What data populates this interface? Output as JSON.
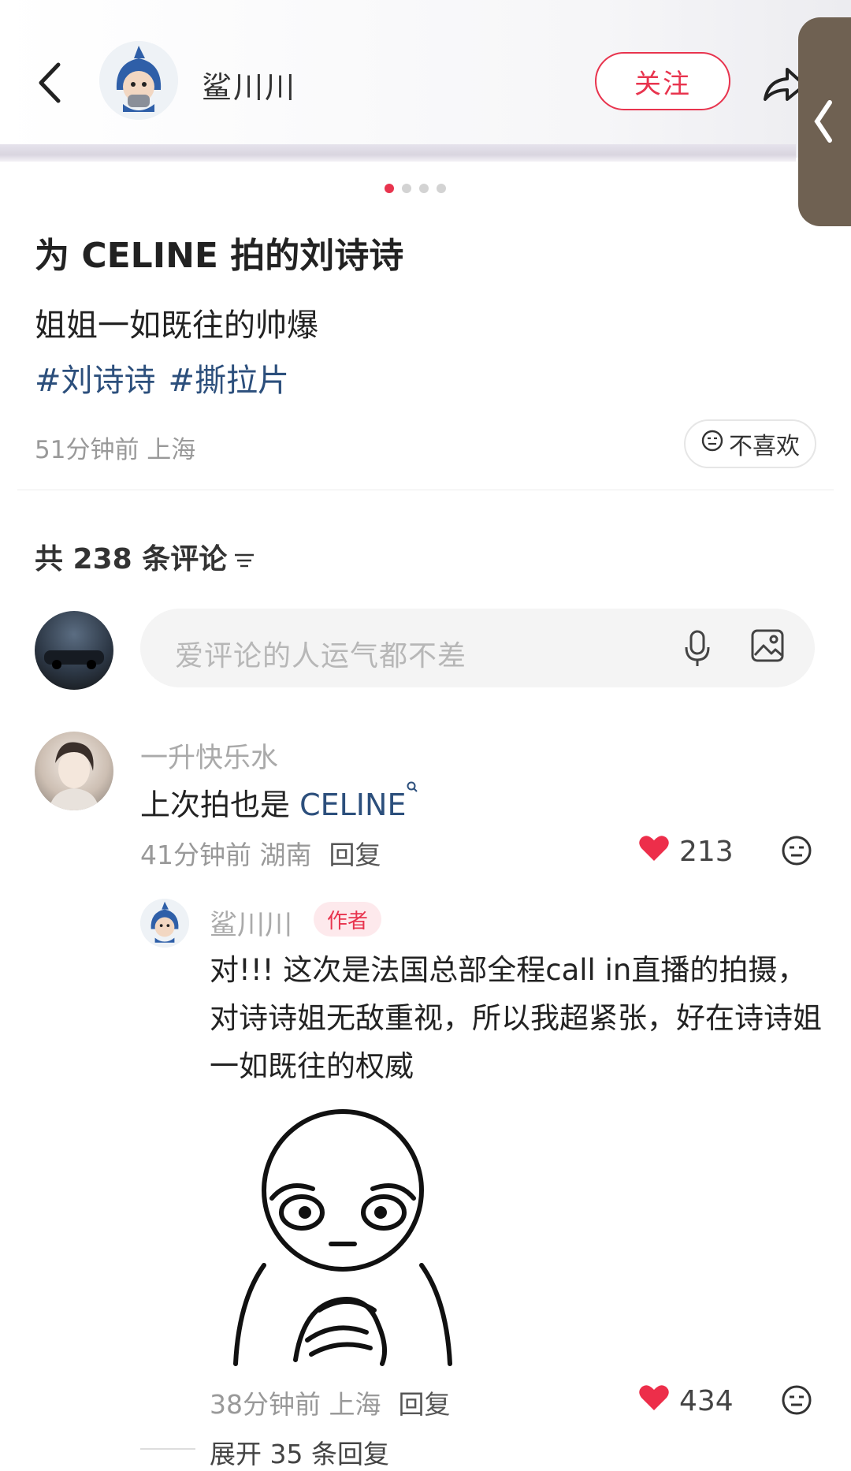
{
  "header": {
    "author_name": "鲨川川",
    "follow_label": "关注",
    "icons": [
      "back-arrow-icon",
      "shark-avatar",
      "share-icon",
      "side-collapse-icon"
    ]
  },
  "post": {
    "title": "为 CELINE 拍的刘诗诗",
    "body": "姐姐一如既往的帅爆",
    "tags": [
      "#刘诗诗",
      "#撕拉片"
    ],
    "meta": "51分钟前  上海",
    "dislike_label": "不喜欢",
    "carousel": {
      "total": 4,
      "active": 1
    }
  },
  "comments_header": {
    "label": "共 238 条评论"
  },
  "comment_input": {
    "placeholder": "爱评论的人运气都不差"
  },
  "comments": [
    {
      "name": "一升快乐水",
      "text_prefix": "上次拍也是 ",
      "text_link": "CELINE",
      "meta": "41分钟前  湖南",
      "reply_label": "回复",
      "likes": "213"
    }
  ],
  "reply": {
    "name": "鲨川川",
    "badge": "作者",
    "text": "对!!! 这次是法国总部全程call in直播的拍摄，对诗诗姐无敌重视，所以我超紧张，好在诗诗姐一如既往的权威",
    "meta": "38分钟前  上海",
    "reply_label": "回复",
    "likes": "434",
    "expand_label": "展开 35 条回复"
  },
  "colors": {
    "accent": "#e8344e",
    "tag": "#2c4f7c",
    "muted": "#999999"
  }
}
